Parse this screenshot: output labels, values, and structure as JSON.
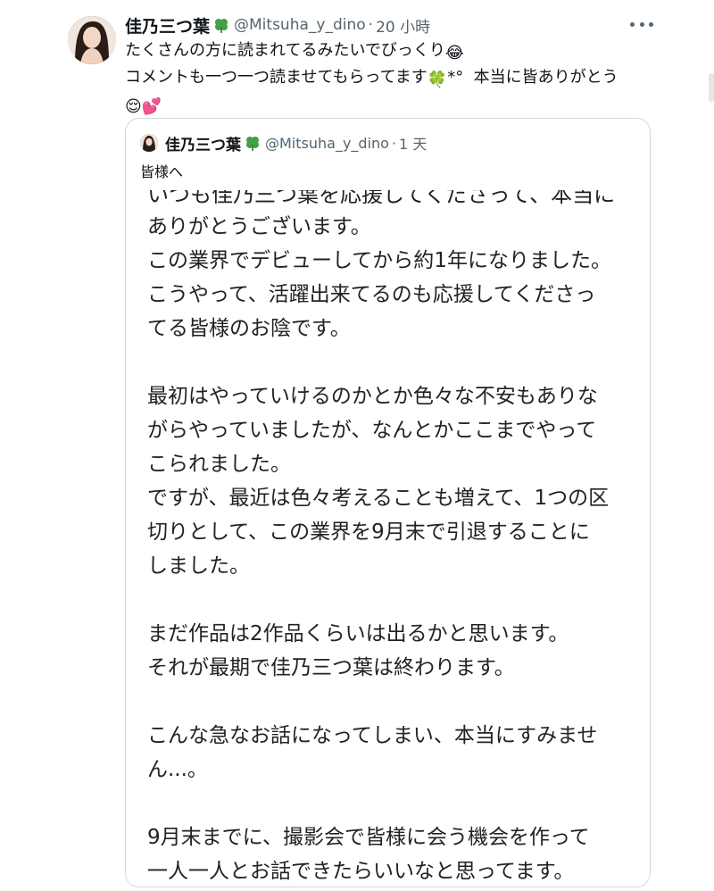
{
  "tweet": {
    "display_name": "佳乃三つ葉",
    "handle": "@Mitsuha_y_dino",
    "separator": "·",
    "time": "20 小時",
    "body_lines": [
      "たくさんの方に読まれてるみたいでびっくり",
      "コメントも一つ一つ読ませてもらってます",
      "本当に皆ありがとう"
    ],
    "emoji": {
      "laugh": "😂",
      "clover": "🍀",
      "sparkle": "*°",
      "relieved": "😌",
      "hearts": "💕"
    }
  },
  "quote": {
    "display_name": "佳乃三つ葉",
    "handle": "@Mitsuha_y_dino",
    "separator": "·",
    "time": "1 天",
    "text": "皆様へ",
    "letter_cut_line": "いつも佳乃三つ葉を応援してくださって、本当に",
    "letter_lines": [
      "ありがとうございます。",
      "この業界でデビューしてから約1年になりました。",
      "こうやって、活躍出来てるのも応援してくださっ",
      "てる皆様のお陰です。",
      "",
      "最初はやっていけるのかとか色々な不安もありな",
      "がらやっていましたが、なんとかここまでやって",
      "こられました。",
      "ですが、最近は色々考えることも増えて、1つの区",
      "切りとして、この業界を9月末で引退することに",
      "しました。",
      "",
      "まだ作品は2作品くらいは出るかと思います。",
      "それが最期で佳乃三つ葉は終わります。",
      "",
      "こんな急なお話になってしまい、本当にすみませ",
      "ん...。",
      "",
      "9月末までに、撮影会で皆様に会う機会を作って",
      "一人一人とお話できたらいいなと思ってます。"
    ]
  },
  "icons": {
    "more": "more-icon",
    "clover": "clover-icon"
  },
  "colors": {
    "text": "#0f1419",
    "secondary": "#536471",
    "border": "#cfd9de",
    "clover": "#4caf50"
  }
}
